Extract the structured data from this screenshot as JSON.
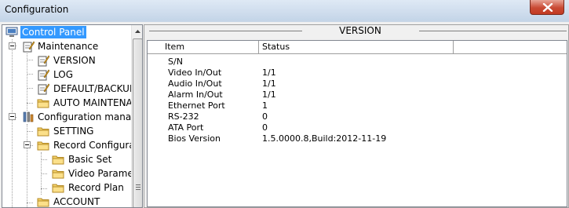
{
  "window": {
    "title": "Configuration"
  },
  "tree": {
    "items": [
      {
        "label": "Control Panel",
        "selected": true,
        "icon": "monitor-icon"
      },
      {
        "label": "Maintenance",
        "icon": "notepad-icon"
      },
      {
        "label": "VERSION",
        "icon": "notepad-icon"
      },
      {
        "label": "LOG",
        "icon": "notepad-icon"
      },
      {
        "label": "DEFAULT/BACKUP",
        "icon": "notepad-icon"
      },
      {
        "label": "AUTO MAINTENAN",
        "icon": "folder-icon"
      },
      {
        "label": "Configuration manage",
        "icon": "tools-icon"
      },
      {
        "label": "SETTING",
        "icon": "folder-icon"
      },
      {
        "label": "Record Configurati",
        "icon": "folder-icon"
      },
      {
        "label": "Basic Set",
        "icon": "folder-icon"
      },
      {
        "label": "Video Paramete",
        "icon": "folder-icon"
      },
      {
        "label": "Record Plan",
        "icon": "folder-icon"
      },
      {
        "label": "ACCOUNT",
        "icon": "folder-icon"
      }
    ]
  },
  "panel": {
    "title": "VERSION",
    "columns": [
      "Item",
      "Status"
    ],
    "rows": [
      {
        "item": "S/N",
        "status": ""
      },
      {
        "item": "Video In/Out",
        "status": "1/1"
      },
      {
        "item": "Audio In/Out",
        "status": "1/1"
      },
      {
        "item": "Alarm In/Out",
        "status": "1/1"
      },
      {
        "item": "Ethernet Port",
        "status": "1"
      },
      {
        "item": "RS-232",
        "status": "0"
      },
      {
        "item": "ATA Port",
        "status": "0"
      },
      {
        "item": "Bios Version",
        "status": "1.5.0000.8,Build:2012-11-19"
      }
    ]
  },
  "colors": {
    "selection": "#3399ff",
    "close_button": "#c94a34"
  }
}
